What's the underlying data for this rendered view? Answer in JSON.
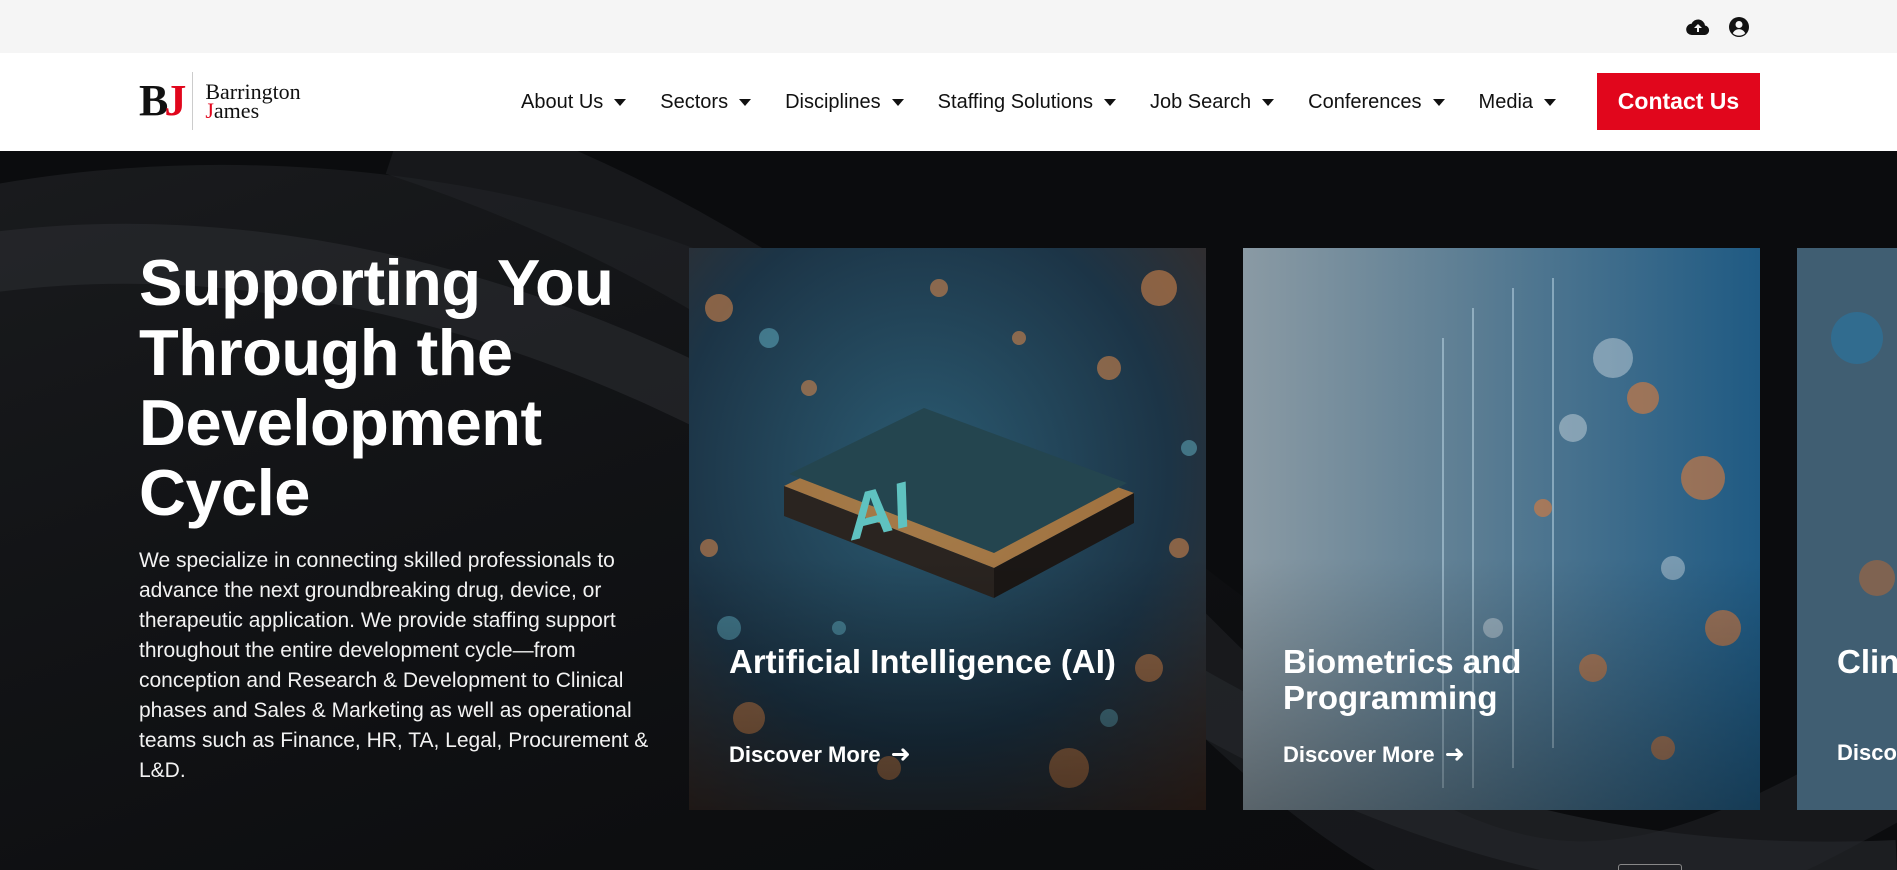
{
  "topbar": {
    "icons": [
      "cloud-upload-icon",
      "account-circle-icon"
    ]
  },
  "logo": {
    "mark_b": "B",
    "mark_j": "J",
    "line1": "Barrington",
    "line2_j": "J",
    "line2_rest": "ames"
  },
  "nav": {
    "items": [
      {
        "label": "About Us"
      },
      {
        "label": "Sectors"
      },
      {
        "label": "Disciplines"
      },
      {
        "label": "Staffing Solutions"
      },
      {
        "label": "Job Search"
      },
      {
        "label": "Conferences"
      },
      {
        "label": "Media"
      }
    ],
    "contact_label": "Contact Us"
  },
  "hero": {
    "title": "Supporting You Through the Development Cycle",
    "text": "We specialize in connecting skilled professionals to advance the next groundbreaking drug, device, or therapeutic application. We provide staffing support throughout the entire development cycle—from conception and Research & Development to Clinical phases and Sales & Marketing as well as operational teams such as Finance, HR, TA, Legal, Procurement & L&D."
  },
  "cards": [
    {
      "title": "Artificial Intelligence (AI)",
      "link": "Discover More",
      "chip_text": "AI"
    },
    {
      "title": "Biometrics and Programming",
      "link": "Discover More"
    },
    {
      "title": "Clin",
      "link": "Disco"
    }
  ],
  "colors": {
    "brand_red": "#e1061c",
    "hero_bg": "#0b0c0e",
    "topbar_bg": "#f5f5f5"
  }
}
